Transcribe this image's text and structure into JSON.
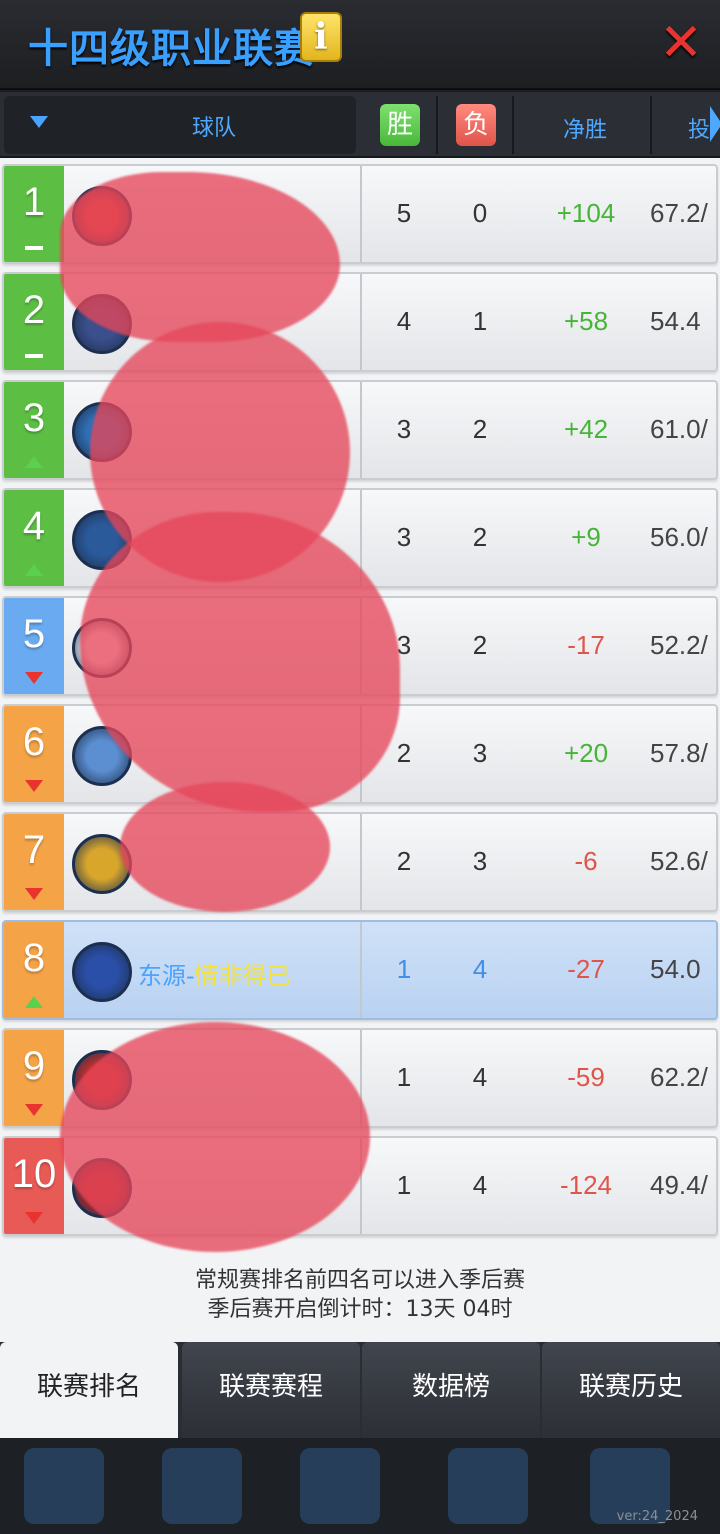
{
  "title": "十四级职业联赛",
  "icons": {
    "info": "info-icon",
    "close": "close-icon"
  },
  "header": {
    "team": "球队",
    "win": "胜",
    "loss": "负",
    "net": "净胜",
    "shoot": "投"
  },
  "rows": [
    {
      "rank": "1",
      "trend": "same",
      "name_a": "",
      "name_b": "",
      "w": "5",
      "l": "0",
      "net": "+104",
      "pct": "67.2/",
      "color": "#5cbf44"
    },
    {
      "rank": "2",
      "trend": "same",
      "name_a": "",
      "name_b": "",
      "w": "4",
      "l": "1",
      "net": "+58",
      "pct": "54.4",
      "color": "#5cbf44"
    },
    {
      "rank": "3",
      "trend": "up",
      "name_a": "",
      "name_b": "",
      "w": "3",
      "l": "2",
      "net": "+42",
      "pct": "61.0/",
      "color": "#5cbf44"
    },
    {
      "rank": "4",
      "trend": "up",
      "name_a": "",
      "name_b": "",
      "w": "3",
      "l": "2",
      "net": "+9",
      "pct": "56.0/",
      "color": "#5cbf44"
    },
    {
      "rank": "5",
      "trend": "down",
      "name_a": "",
      "name_b": "",
      "w": "3",
      "l": "2",
      "net": "-17",
      "pct": "52.2/",
      "color": "#6aaaf0"
    },
    {
      "rank": "6",
      "trend": "down",
      "name_a": "",
      "name_b": "",
      "w": "2",
      "l": "3",
      "net": "+20",
      "pct": "57.8/",
      "color": "#f4a347"
    },
    {
      "rank": "7",
      "trend": "down",
      "name_a": "",
      "name_b": "",
      "w": "2",
      "l": "3",
      "net": "-6",
      "pct": "52.6/",
      "color": "#f4a347"
    },
    {
      "rank": "8",
      "trend": "up",
      "name_a": "东源-",
      "name_b": "情非得已",
      "w": "1",
      "l": "4",
      "net": "-27",
      "pct": "54.0",
      "color": "#f4a347"
    },
    {
      "rank": "9",
      "trend": "down",
      "name_a": "",
      "name_b": "",
      "w": "1",
      "l": "4",
      "net": "-59",
      "pct": "62.2/",
      "color": "#f4a347"
    },
    {
      "rank": "10",
      "trend": "down",
      "name_a": "",
      "name_b": "",
      "w": "1",
      "l": "4",
      "net": "-124",
      "pct": "49.4/",
      "color": "#e85a55"
    }
  ],
  "note": {
    "line1": "常规赛排名前四名可以进入季后赛",
    "line2": "季后赛开启倒计时：13天 04时"
  },
  "tabs": [
    "联赛排名",
    "联赛赛程",
    "数据榜",
    "联赛历史"
  ],
  "version": "ver:24_2024"
}
